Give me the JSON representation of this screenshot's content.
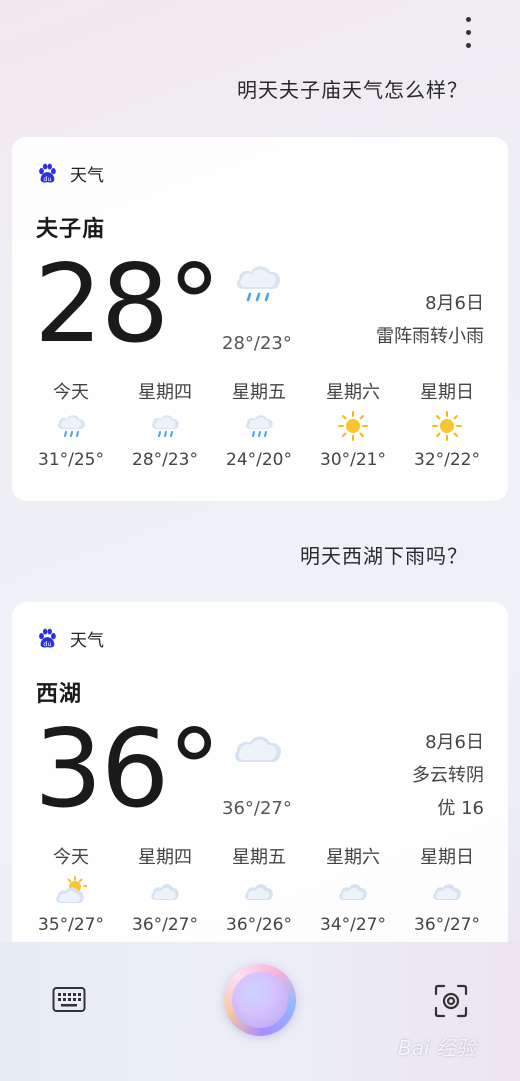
{
  "conversation": {
    "question1": "明天夫子庙天气怎么样？",
    "question2": "明天西湖下雨吗？"
  },
  "cards": [
    {
      "source_label": "天气",
      "city": "夫子庙",
      "temp": "28°",
      "current_icon": "cloud-rain-icon",
      "range": "28°/23°",
      "date": "8月6日",
      "condition": "雷阵雨转小雨",
      "aqi": "",
      "forecast": [
        {
          "day": "今天",
          "icon": "cloud-rain-icon",
          "range": "31°/25°"
        },
        {
          "day": "星期四",
          "icon": "cloud-rain-icon",
          "range": "28°/23°"
        },
        {
          "day": "星期五",
          "icon": "cloud-rain-icon",
          "range": "24°/20°"
        },
        {
          "day": "星期六",
          "icon": "sun-icon",
          "range": "30°/21°"
        },
        {
          "day": "星期日",
          "icon": "sun-icon",
          "range": "32°/22°"
        }
      ]
    },
    {
      "source_label": "天气",
      "city": "西湖",
      "temp": "36°",
      "current_icon": "cloud-icon",
      "range": "36°/27°",
      "date": "8月6日",
      "condition": "多云转阴",
      "aqi": "优 16",
      "forecast": [
        {
          "day": "今天",
          "icon": "sun-cloud-icon",
          "range": "35°/27°"
        },
        {
          "day": "星期四",
          "icon": "cloud-icon",
          "range": "36°/27°"
        },
        {
          "day": "星期五",
          "icon": "cloud-icon",
          "range": "36°/26°"
        },
        {
          "day": "星期六",
          "icon": "cloud-icon",
          "range": "34°/27°"
        },
        {
          "day": "星期日",
          "icon": "cloud-icon",
          "range": "36°/27°"
        }
      ]
    }
  ],
  "watermark": "Bai 经验",
  "colors": {
    "text_primary": "#1a1a1a",
    "baidu_blue": "#2932e1",
    "rain_blue": "#4aa3f0",
    "sun_yellow": "#f5b823"
  }
}
